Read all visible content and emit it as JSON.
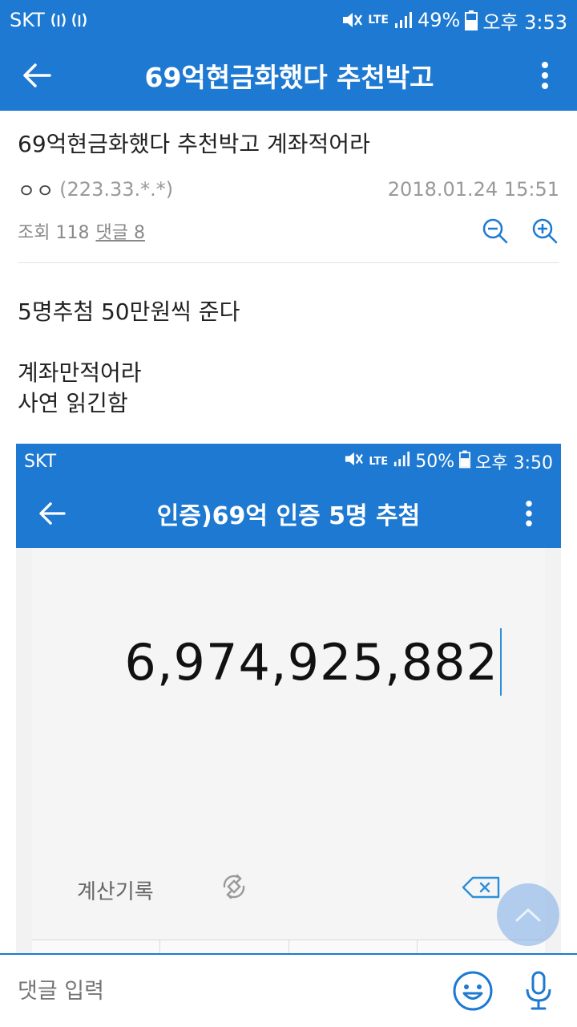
{
  "status_bar": {
    "carrier": "SKT",
    "battery": "49%",
    "time": "오후 3:53",
    "network": "LTE"
  },
  "app_bar": {
    "title": "69억현금화했다 추천박고"
  },
  "post": {
    "title": "69억현금화했다 추천박고 계좌적어라",
    "author": "ㅇㅇ",
    "ip": "(223.33.*.*)",
    "date": "2018.01.24 15:51",
    "views_label": "조회 118",
    "comments_label": "댓글 8",
    "body": {
      "line1": "5명추첨 50만원씩 준다",
      "line2": "계좌만적어라",
      "line3": "사연 읽긴함"
    }
  },
  "embedded_screenshot": {
    "status_bar": {
      "carrier": "SKT",
      "battery": "50%",
      "time": "오후 3:50",
      "network": "LTE"
    },
    "app_bar_title": "인증)69억 인증 5명 추첨",
    "calculator": {
      "display_value": "6,974,925,882",
      "history_label": "계산기록"
    }
  },
  "comment_bar": {
    "placeholder": "댓글 입력"
  },
  "colors": {
    "primary": "#1e79d2",
    "text": "#222222",
    "muted": "#999999"
  }
}
